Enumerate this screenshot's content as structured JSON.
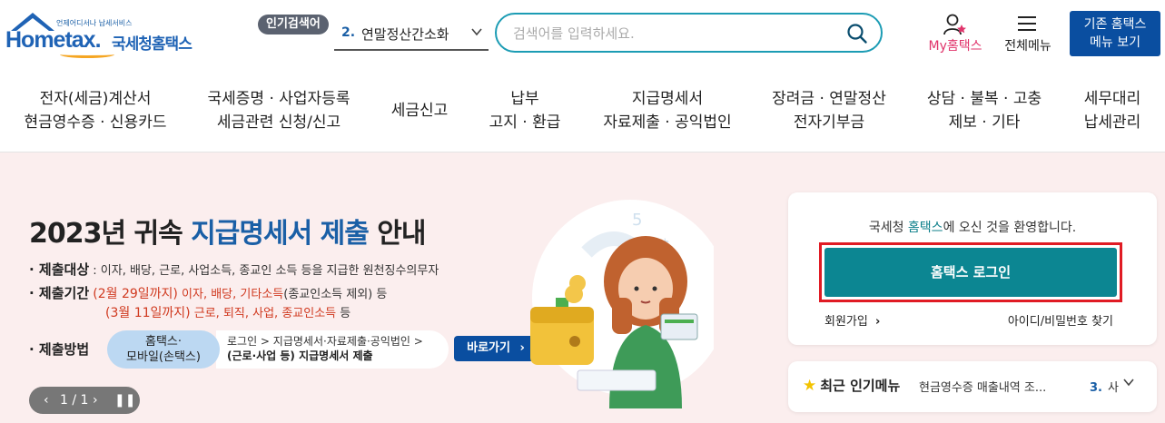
{
  "header": {
    "logo_tagline": "언제어디서나 납세서비스",
    "logo_main": "Hometax.",
    "logo_kr": "국세청홈택스",
    "popular_badge": "인기검색어",
    "popular_rank": "2.",
    "popular_term": "연말정산간소화",
    "search_placeholder": "검색어를 입력하세요.",
    "my_hometax_label": "My홈택스",
    "all_menu_label": "전체메뉴",
    "old_hometax_line1": "기존 홈택스",
    "old_hometax_line2": "메뉴 보기"
  },
  "gnb": [
    {
      "line1": "전자(세금)계산서",
      "line2": "현금영수증 · 신용카드"
    },
    {
      "line1": "국세증명 · 사업자등록",
      "line2": "세금관련 신청/신고"
    },
    {
      "line1": "세금신고",
      "line2": ""
    },
    {
      "line1": "납부",
      "line2": "고지 · 환급"
    },
    {
      "line1": "지급명세서",
      "line2": "자료제출 · 공익법인"
    },
    {
      "line1": "장려금 · 연말정산",
      "line2": "전자기부금"
    },
    {
      "line1": "상담 · 불복 · 고충",
      "line2": "제보 · 기타"
    },
    {
      "line1": "세무대리",
      "line2": "납세관리"
    }
  ],
  "banner": {
    "title_pre": "2023년 귀속 ",
    "title_hl": "지급명세서 제출",
    "title_post": " 안내",
    "subject_key": "· 제출대상",
    "subject_val": ": 이자, 배당, 근로, 사업소득, 종교인 소득 등을 지급한 원천징수의무자",
    "period_key": "· 제출기간",
    "period_l1_date": "(2월 29일까지)",
    "period_l1_items": "이자, 배당, 기타소득",
    "period_l1_note": "(종교인소득 제외) 등",
    "period_l2_date": "(3월 11일까지)",
    "period_l2_items": "근로, 퇴직, 사업, 종교인소득",
    "period_l2_note": "등",
    "method_key": "· 제출방법",
    "method_pill_l1": "홈택스·",
    "method_pill_l2": "모바일(손택스)",
    "method_path_l1": "로그인 > 지급명세서·자료제출·공익법인 >",
    "method_path_l2": "(근로·사업 등) 지급명세서 제출",
    "goto_label": "바로가기",
    "pager_text": "1 / 1"
  },
  "login": {
    "welcome_pre": "국세청 ",
    "welcome_brand": "홈택스",
    "welcome_post": "에 오신 것을 환영합니다.",
    "login_button": "홈택스 로그인",
    "join_link": "회원가입",
    "find_link": "아이디/비밀번호 찾기"
  },
  "popular_menu": {
    "title": "최근 인기메뉴",
    "current_item": "현금영수증 매출내역 조...",
    "next_rank": "3.",
    "next_item": "사"
  },
  "colors": {
    "brand_blue": "#0a4ea0",
    "teal": "#0c8692",
    "banner_bg": "#fbeeee",
    "highlight_red": "#e01b24"
  }
}
